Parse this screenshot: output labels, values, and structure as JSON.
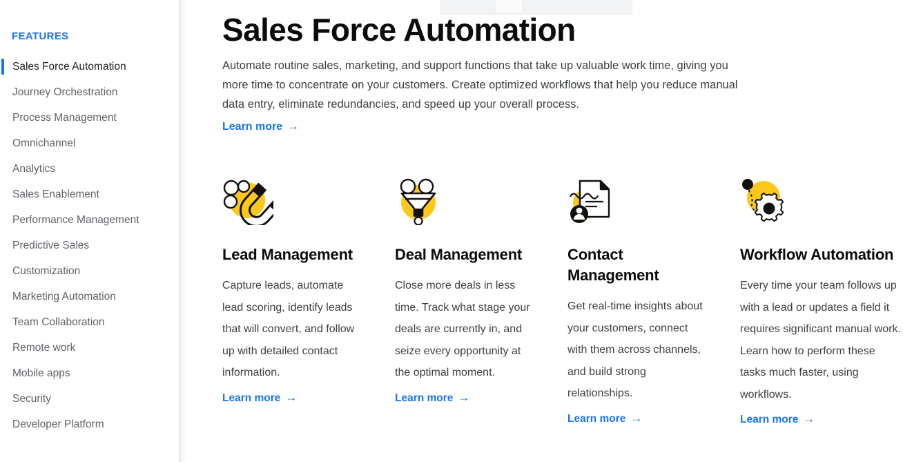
{
  "sidebar": {
    "heading": "FEATURES",
    "items": [
      {
        "label": "Sales Force Automation",
        "active": true
      },
      {
        "label": "Journey Orchestration",
        "active": false
      },
      {
        "label": "Process Management",
        "active": false
      },
      {
        "label": "Omnichannel",
        "active": false
      },
      {
        "label": "Analytics",
        "active": false
      },
      {
        "label": "Sales Enablement",
        "active": false
      },
      {
        "label": "Performance Management",
        "active": false
      },
      {
        "label": "Predictive Sales",
        "active": false
      },
      {
        "label": "Customization",
        "active": false
      },
      {
        "label": "Marketing Automation",
        "active": false
      },
      {
        "label": "Team Collaboration",
        "active": false
      },
      {
        "label": "Remote work",
        "active": false
      },
      {
        "label": "Mobile apps",
        "active": false
      },
      {
        "label": "Security",
        "active": false
      },
      {
        "label": "Developer Platform",
        "active": false
      }
    ]
  },
  "main": {
    "title": "Sales Force Automation",
    "intro": "Automate routine sales, marketing, and support functions that take up valuable work time, giving you more time to concentrate on your customers. Create optimized workflows that help you reduce manual data entry, eliminate redundancies, and speed up your overall process.",
    "learn_more_label": "Learn more",
    "learn_more_arrow": "→",
    "cards": [
      {
        "icon": "magnet-icon",
        "title": "Lead Management",
        "body": "Capture leads, automate lead scoring, identify leads that will convert, and follow up with detailed contact information.",
        "link_label": "Learn more",
        "link_arrow": "→"
      },
      {
        "icon": "funnel-icon",
        "title": "Deal Management",
        "body": "Close more deals in less time. Track what stage your deals are currently in, and seize every opportunity at the optimal moment.",
        "link_label": "Learn more",
        "link_arrow": "→"
      },
      {
        "icon": "contact-document-icon",
        "title": "Contact Management",
        "body": "Get real-time insights about your customers, connect with them across channels, and build strong relationships.",
        "link_label": "Learn more",
        "link_arrow": "→"
      },
      {
        "icon": "gear-workflow-icon",
        "title": "Workflow Automation",
        "body": "Every time your team follows up with a lead or updates a field it requires significant manual work. Learn how to perform these tasks much faster, using workflows.",
        "link_label": "Learn more",
        "link_arrow": "→"
      }
    ]
  },
  "colors": {
    "accent_blue": "#1a73e8",
    "icon_yellow": "#FCC81B",
    "title_black": "#0b0b0b",
    "body_gray": "#3c4043",
    "nav_gray": "#5f6368"
  }
}
